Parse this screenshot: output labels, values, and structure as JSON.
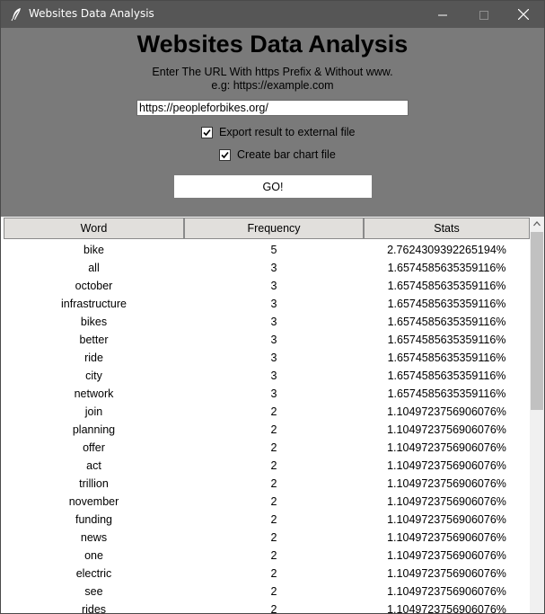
{
  "window": {
    "title": "Websites Data Analysis",
    "icons": {
      "app": "feather-icon",
      "minimize": "minimize-icon",
      "maximize": "maximize-icon",
      "close": "close-icon"
    }
  },
  "panel": {
    "heading": "Websites Data Analysis",
    "instruction_line1": "Enter The URL With https Prefix & Without www.",
    "instruction_line2": "e.g: https://example.com",
    "url_value": "https://peopleforbikes.org/",
    "export_label": "Export result to external file",
    "export_checked": true,
    "chart_label": "Create bar chart file",
    "chart_checked": true,
    "go_label": "GO!"
  },
  "table": {
    "columns": [
      "Word",
      "Frequency",
      "Stats"
    ],
    "rows": [
      [
        "bike",
        "5",
        "2.7624309392265194%"
      ],
      [
        "all",
        "3",
        "1.6574585635359116%"
      ],
      [
        "october",
        "3",
        "1.6574585635359116%"
      ],
      [
        "infrastructure",
        "3",
        "1.6574585635359116%"
      ],
      [
        "bikes",
        "3",
        "1.6574585635359116%"
      ],
      [
        "better",
        "3",
        "1.6574585635359116%"
      ],
      [
        "ride",
        "3",
        "1.6574585635359116%"
      ],
      [
        "city",
        "3",
        "1.6574585635359116%"
      ],
      [
        "network",
        "3",
        "1.6574585635359116%"
      ],
      [
        "join",
        "2",
        "1.1049723756906076%"
      ],
      [
        "planning",
        "2",
        "1.1049723756906076%"
      ],
      [
        "offer",
        "2",
        "1.1049723756906076%"
      ],
      [
        "act",
        "2",
        "1.1049723756906076%"
      ],
      [
        "trillion",
        "2",
        "1.1049723756906076%"
      ],
      [
        "november",
        "2",
        "1.1049723756906076%"
      ],
      [
        "funding",
        "2",
        "1.1049723756906076%"
      ],
      [
        "news",
        "2",
        "1.1049723756906076%"
      ],
      [
        "one",
        "2",
        "1.1049723756906076%"
      ],
      [
        "electric",
        "2",
        "1.1049723756906076%"
      ],
      [
        "see",
        "2",
        "1.1049723756906076%"
      ],
      [
        "rides",
        "2",
        "1.1049723756906076%"
      ]
    ]
  },
  "colors": {
    "titlebar": "#565656",
    "panel": "#7a7a7a",
    "header": "#e1dfdc"
  }
}
